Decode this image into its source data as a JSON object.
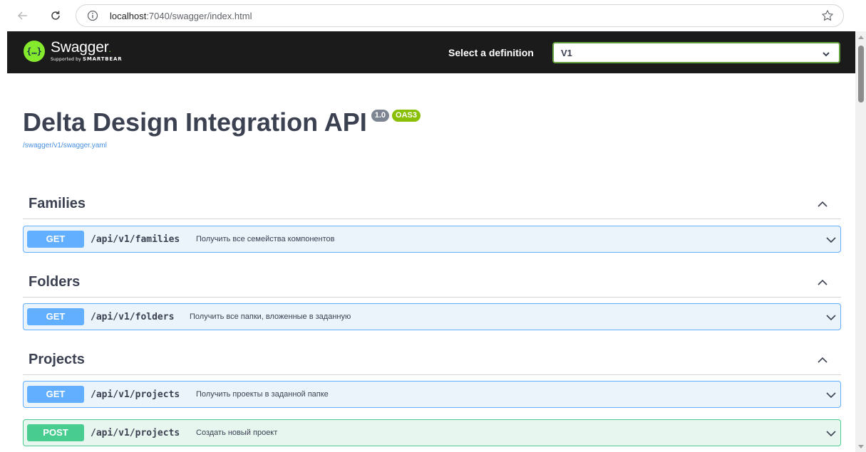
{
  "browser": {
    "url_host": "localhost",
    "url_path": ":7040/swagger/index.html",
    "back_icon": "arrow-left-icon",
    "reload_icon": "reload-icon",
    "info_icon": "info-circle-icon",
    "bookmark_icon": "star-outline-icon"
  },
  "topbar": {
    "logo_mark": "{…}",
    "logo_name": "Swagger",
    "logo_dot": ".",
    "logo_sub_prefix": "Supported by ",
    "logo_sub_brand": "SMARTBEAR",
    "definition_label": "Select a definition",
    "definition_value": "V1",
    "accent_color": "#85ea2d"
  },
  "info": {
    "title": "Delta Design Integration API",
    "version_badge": "1.0",
    "oas_badge": "OAS3",
    "spec_link": "/swagger/v1/swagger.yaml"
  },
  "sections": [
    {
      "tag": "Families",
      "operations": [
        {
          "method": "GET",
          "path": "/api/v1/families",
          "summary": "Получить все семейства компонентов"
        }
      ]
    },
    {
      "tag": "Folders",
      "operations": [
        {
          "method": "GET",
          "path": "/api/v1/folders",
          "summary": "Получить все папки, вложенные в заданную"
        }
      ]
    },
    {
      "tag": "Projects",
      "operations": [
        {
          "method": "GET",
          "path": "/api/v1/projects",
          "summary": "Получить проекты в заданной папке"
        },
        {
          "method": "POST",
          "path": "/api/v1/projects",
          "summary": "Создать новый проект"
        }
      ]
    }
  ],
  "colors": {
    "get": "#61affe",
    "post": "#49cc90",
    "topbar_bg": "#1b1b1b",
    "select_border": "#62a03f"
  }
}
